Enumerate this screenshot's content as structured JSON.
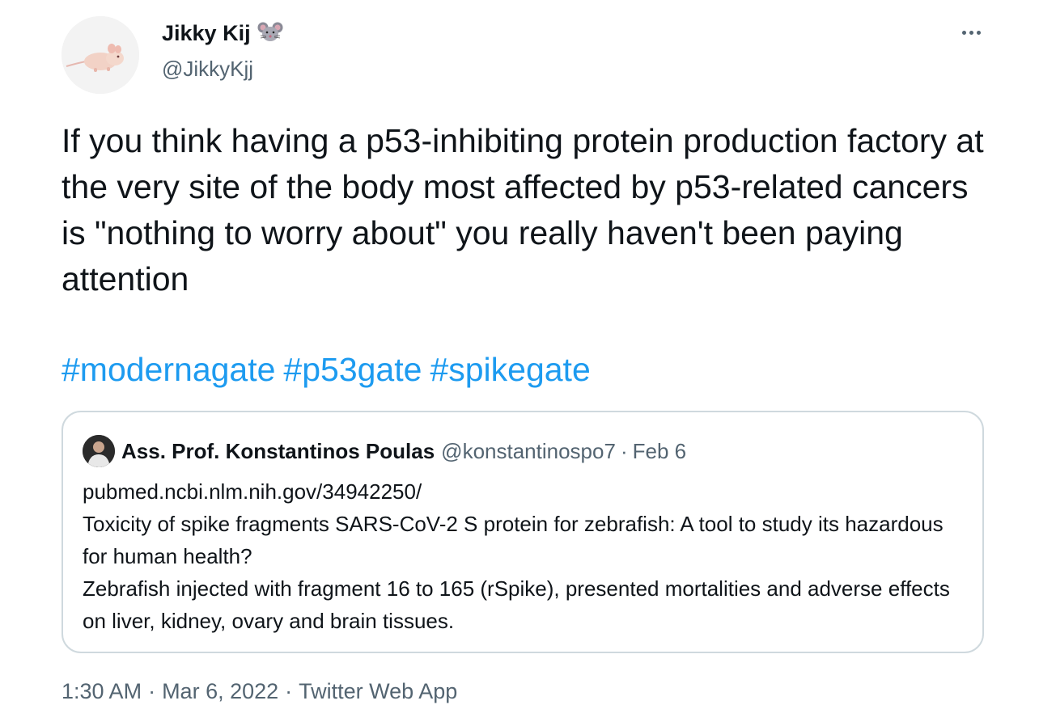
{
  "author": {
    "display_name": "Jikky Kij",
    "handle": "@JikkyKjj",
    "name_emoji": "mouse-face-icon"
  },
  "tweet": {
    "text": "If you think having a p53-inhibiting protein production factory at the very site of the body most affected by p53-related cancers is \"nothing to worry about\" you really haven't been paying attention",
    "hashtags": [
      "#modernagate",
      "#p53gate",
      "#spikegate"
    ]
  },
  "quoted_tweet": {
    "author_name": "Ass. Prof. Konstantinos Poulas",
    "author_handle": "@konstantinospo7",
    "separator": "·",
    "date": "Feb 6",
    "lines": [
      "pubmed.ncbi.nlm.nih.gov/34942250/",
      "Toxicity of spike fragments SARS-CoV-2 S protein for zebrafish: A tool to study its hazardous for human health?",
      "Zebrafish injected with fragment 16 to 165 (rSpike), presented mortalities and adverse effects on liver, kidney, ovary and brain tissues."
    ]
  },
  "footer": {
    "time": "1:30 AM",
    "separator": "·",
    "date": "Mar 6, 2022",
    "source": "Twitter Web App"
  },
  "colors": {
    "text": "#0f1419",
    "secondary": "#536471",
    "link": "#1d9bf0",
    "border": "#cfd9de"
  }
}
